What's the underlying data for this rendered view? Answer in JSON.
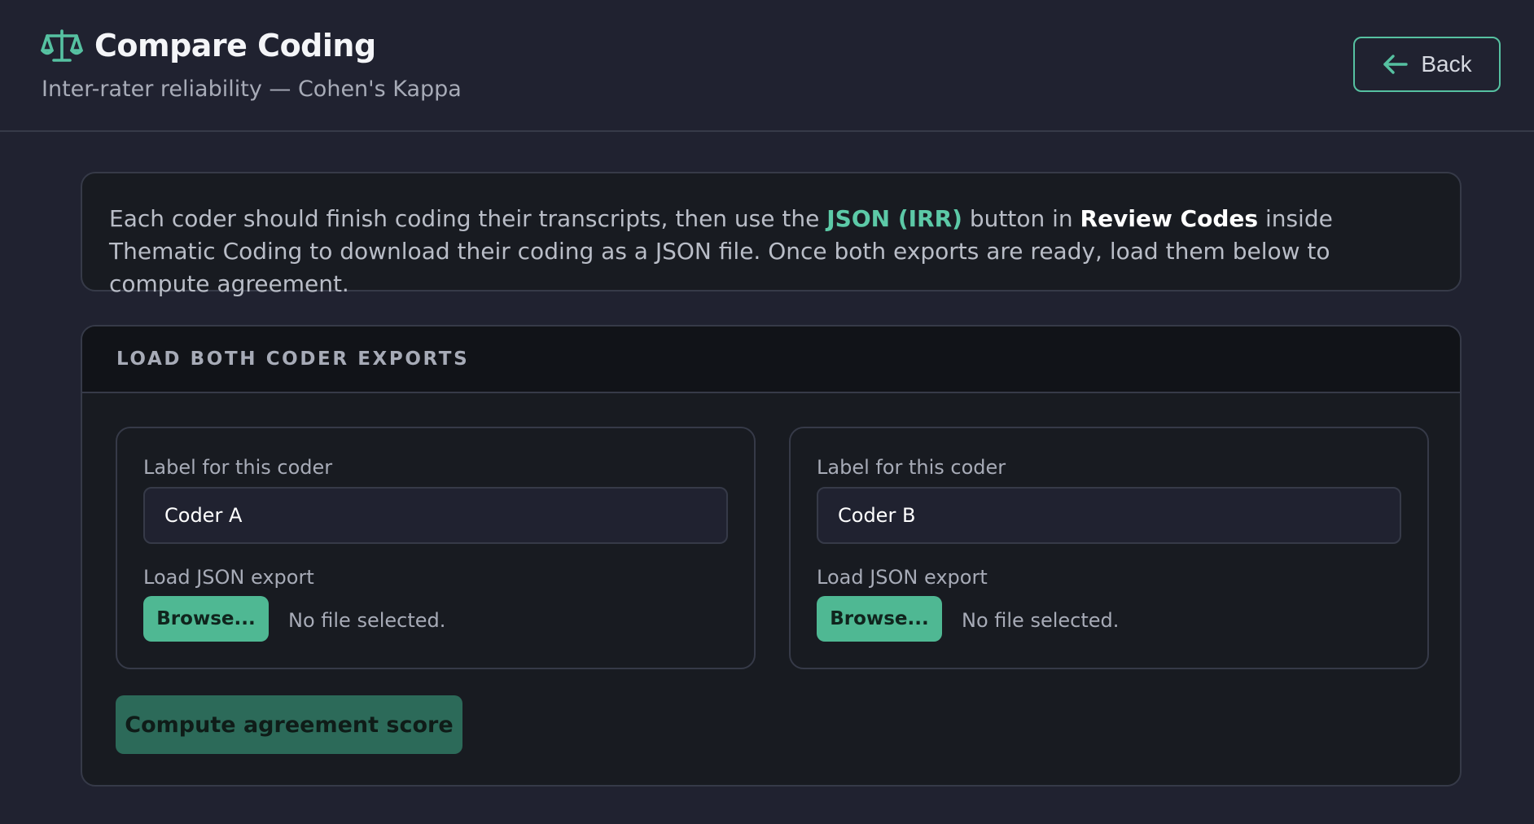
{
  "header": {
    "icon": "balance-scale-icon",
    "title": "Compare Coding",
    "subtitle": "Inter-rater reliability — Cohen's Kappa",
    "back_label": "Back",
    "back_icon": "arrow-left-icon"
  },
  "info": {
    "part1": "Each coder should finish coding their transcripts, then use the ",
    "highlight": "JSON (IRR)",
    "part2": " button in ",
    "strong": "Review Codes",
    "part3": " inside Thematic Coding to download their coding as a JSON file. Once both exports are ready, load them below to compute agreement."
  },
  "load_section": {
    "title": "LOAD BOTH CODER EXPORTS",
    "coders": [
      {
        "label_caption": "Label for this coder",
        "label_value": "Coder A",
        "json_caption": "Load JSON export",
        "browse_label": "Browse...",
        "file_status": "No file selected."
      },
      {
        "label_caption": "Label for this coder",
        "label_value": "Coder B",
        "json_caption": "Load JSON export",
        "browse_label": "Browse...",
        "file_status": "No file selected."
      }
    ],
    "compute_label": "Compute agreement score"
  },
  "colors": {
    "accent": "#56c1a1",
    "background": "#202230",
    "card": "#181b21",
    "compute_disabled": "#2c6a59"
  }
}
